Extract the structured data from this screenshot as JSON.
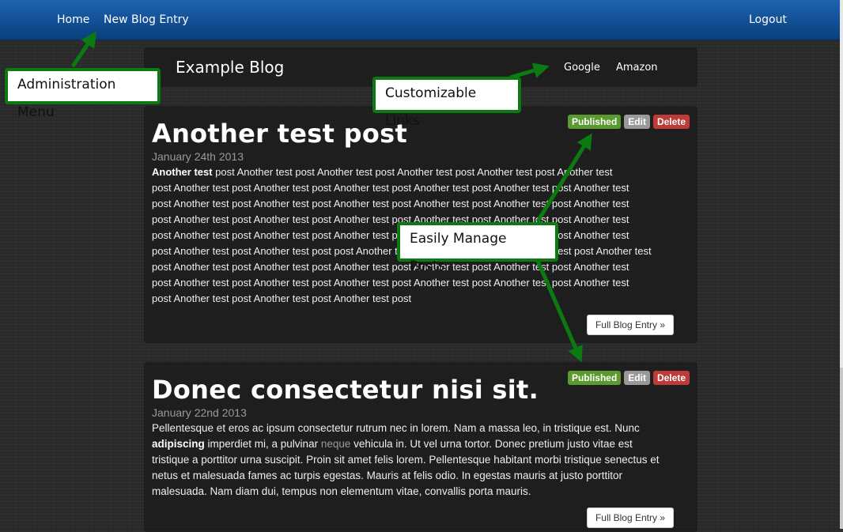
{
  "topbar": {
    "home": "Home",
    "new_entry": "New Blog Entry",
    "logout": "Logout"
  },
  "blog": {
    "title": "Example Blog",
    "links": [
      "Google",
      "Amazon"
    ]
  },
  "posts": [
    {
      "title": "Another test post",
      "date": "January 24th 2013",
      "body_bold": "Another test",
      "body_lines": [
        " post Another test post Another test post Another test post Another test post Another test",
        "post Another test post Another test post Another test post Another test post Another test post Another test",
        "post Another test post Another test post Another test post Another test post Another test post Another test",
        "post Another test post Another test post Another test post Another test post Another test post Another test",
        "post Another test post Another test post Another test post Another test post Another test post Another test",
        "post Another test post Another test post post Another test post Another test post Another test post Another test",
        "post Another test post Another test post Another test post Another test post Another test post Another test",
        "post Another test post Another test post Another test post Another test post Another test post Another test",
        "post Another test post Another test post Another test post"
      ],
      "badges": {
        "published": "Published",
        "edit": "Edit",
        "delete": "Delete"
      },
      "full_entry": "Full Blog Entry »"
    },
    {
      "title": "Donec consectetur nisi sit.",
      "date": "January 22nd 2013",
      "line1": "Pellentesque et eros ac ipsum consectetur rutrum nec in lorem. Nam a massa leo, in tristique est. Nunc",
      "line2_bold": "adipiscing",
      "line2_a": " imperdiet mi, a pulvinar ",
      "line2_muted": "neque",
      "line2_b": " vehicula in. Ut vel urna tortor. Donec pretium justo vitae est",
      "line3": "tristique a porttitor urna suscipit. Proin sit amet felis lorem. Pellentesque habitant morbi tristique senectus et",
      "line4": "netus et malesuada fames ac turpis egestas. Mauris at felis odio. In egestas mauris at justo porttitor",
      "line5": "malesuada. Nam diam dui, tempus non elementum vitae, convallis porta mauris.",
      "badges": {
        "published": "Published",
        "edit": "Edit",
        "delete": "Delete"
      },
      "full_entry": "Full Blog Entry »"
    }
  ],
  "callouts": {
    "admin_menu": "Administration Menu",
    "custom_links": "Customizable Links",
    "manage_posts": "Easily Manage Posts"
  },
  "colors": {
    "navbar": "#0a3f7d",
    "callout_border": "#0b7a11",
    "published": "#5a9a2e",
    "delete": "#bd3b3b"
  }
}
